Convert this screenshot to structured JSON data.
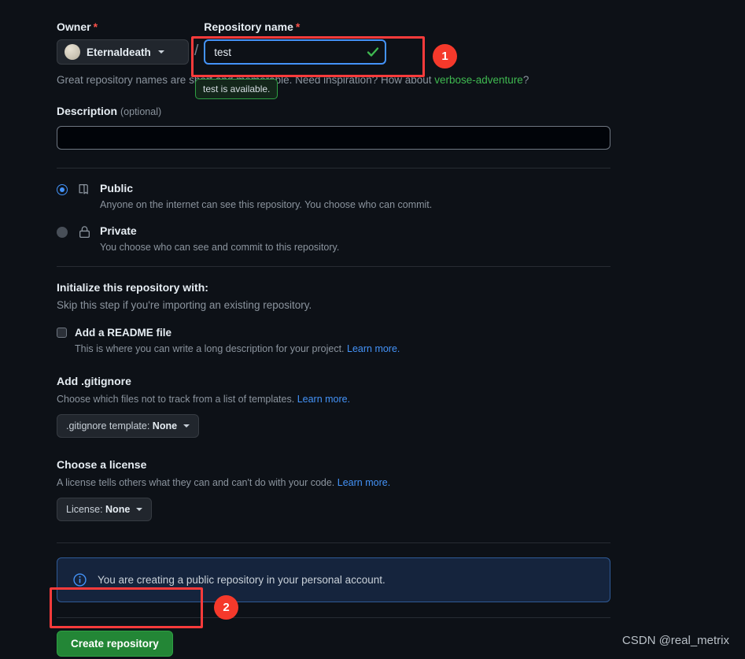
{
  "owner": {
    "label": "Owner",
    "required_mark": "*",
    "name": "Eternaldeath",
    "avatar_icon": "user-avatar"
  },
  "repo_name": {
    "label": "Repository name",
    "required_mark": "*",
    "value": "test",
    "placeholder": "",
    "valid_icon": "check-icon",
    "tooltip": "test is available.",
    "helper_prefix": "Great repository names are short and memorable. Need inspiration? How about ",
    "helper_suggestion": "verbose-adventure",
    "helper_suffix": "?"
  },
  "separator": "/",
  "description": {
    "label": "Description",
    "optional": "(optional)",
    "value": "",
    "placeholder": ""
  },
  "visibility": {
    "public": {
      "title": "Public",
      "desc": "Anyone on the internet can see this repository. You choose who can commit.",
      "selected": true,
      "icon": "repo-book-icon"
    },
    "private": {
      "title": "Private",
      "desc": "You choose who can see and commit to this repository.",
      "selected": false,
      "icon": "lock-icon"
    }
  },
  "initialize": {
    "title": "Initialize this repository with:",
    "subtitle": "Skip this step if you're importing an existing repository.",
    "readme": {
      "label": "Add a README file",
      "checked": false,
      "desc_prefix": "This is where you can write a long description for your project. ",
      "desc_link": "Learn more."
    },
    "gitignore": {
      "title": "Add .gitignore",
      "desc_prefix": "Choose which files not to track from a list of templates. ",
      "desc_link": "Learn more.",
      "button_prefix": ".gitignore template: ",
      "button_value": "None"
    },
    "license": {
      "title": "Choose a license",
      "desc_prefix": "A license tells others what they can and can't do with your code. ",
      "desc_link": "Learn more.",
      "button_prefix": "License: ",
      "button_value": "None"
    }
  },
  "info_banner": {
    "icon": "info-icon",
    "text": "You are creating a public repository in your personal account."
  },
  "submit": {
    "label": "Create repository"
  },
  "annotations": {
    "badge_1": "1",
    "badge_2": "2",
    "color": "#f5392b"
  },
  "watermark": "CSDN @real_metrix",
  "colors": {
    "background": "#0d1117",
    "accent_blue": "#4493f8",
    "success_green": "#3fb950",
    "button_green": "#238636",
    "required_red": "#f85149",
    "annotation_red": "#f5392b"
  }
}
